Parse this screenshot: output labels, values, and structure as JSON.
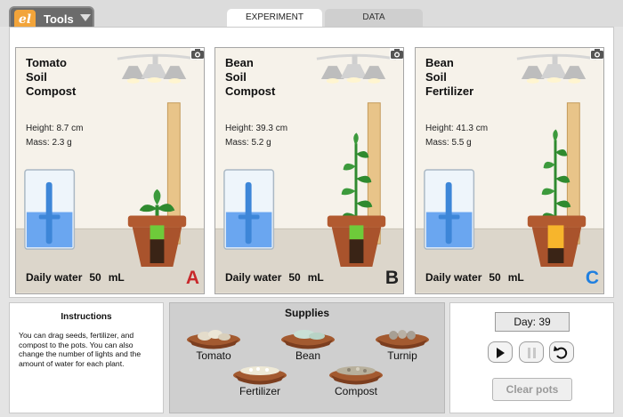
{
  "toolbar": {
    "logo": "el",
    "tools_label": "Tools"
  },
  "tabs": [
    {
      "label": "EXPERIMENT",
      "active": true
    },
    {
      "label": "DATA",
      "active": false
    }
  ],
  "panels": [
    {
      "id": "A",
      "title": [
        "Tomato",
        "Soil",
        "Compost"
      ],
      "height": "Height: 8.7 cm",
      "mass": "Mass: 2.3 g",
      "water_label": "Daily water",
      "water_value": "50",
      "water_unit": "mL",
      "label_color": "#c8282b",
      "fertilizer": false
    },
    {
      "id": "B",
      "title": [
        "Bean",
        "Soil",
        "Compost"
      ],
      "height": "Height: 39.3 cm",
      "mass": "Mass: 5.2 g",
      "water_label": "Daily water",
      "water_value": "50",
      "water_unit": "mL",
      "label_color": "#222222",
      "fertilizer": false
    },
    {
      "id": "C",
      "title": [
        "Bean",
        "Soil",
        "Fertilizer"
      ],
      "height": "Height: 41.3 cm",
      "mass": "Mass: 5.5 g",
      "water_label": "Daily water",
      "water_value": "50",
      "water_unit": "mL",
      "label_color": "#1f7fe0",
      "fertilizer": true
    }
  ],
  "instructions": {
    "title": "Instructions",
    "body": "You can drag seeds, fertilizer, and compost to the pots. You can also change the number of lights and the amount of water for each plant."
  },
  "supplies": {
    "title": "Supplies",
    "items": [
      {
        "label": "Tomato"
      },
      {
        "label": "Bean"
      },
      {
        "label": "Turnip"
      },
      {
        "label": "Fertilizer"
      },
      {
        "label": "Compost"
      }
    ]
  },
  "controls": {
    "day": "Day: 39",
    "clear_label": "Clear pots"
  },
  "colors": {
    "accent_orange": "#f2a43a",
    "water_blue": "#6aa6f0",
    "pot_brown": "#a9532c"
  },
  "icons": [
    "camera-icon",
    "play-icon",
    "pause-icon",
    "reset-icon",
    "dropdown-caret-icon"
  ]
}
